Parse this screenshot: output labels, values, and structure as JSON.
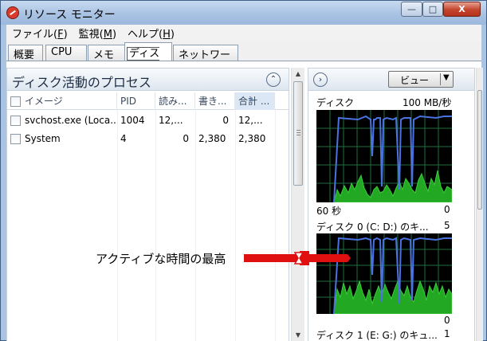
{
  "window": {
    "title": "リソース モニター",
    "min_symbol": "—",
    "max_symbol": "□",
    "close_symbol": "X"
  },
  "menu": [
    {
      "label": "ファイル(",
      "key": "F",
      "end": ")"
    },
    {
      "label": "監視(",
      "key": "M",
      "end": ")"
    },
    {
      "label": "ヘルプ(",
      "key": "H",
      "end": ")"
    }
  ],
  "tabs": [
    "概要",
    "CPU",
    "メモリ",
    "ディスク",
    "ネットワーク"
  ],
  "active_tab": "ディスク",
  "process_panel": {
    "title": "ディスク活動のプロセス",
    "collapse_symbol": "⌃",
    "columns": [
      "イメージ",
      "PID",
      "読み...",
      "書き...",
      "合計 ..."
    ],
    "rows": [
      {
        "image": "svchost.exe (Loca...",
        "pid": "1004",
        "read": "12,...",
        "write": "0",
        "total": "12,..."
      },
      {
        "image": "System",
        "pid": "4",
        "read": "0",
        "write": "2,380",
        "total": "2,380"
      }
    ]
  },
  "graphs_panel": {
    "expand_symbol": "›",
    "view_label": "ビュー",
    "graphs": [
      {
        "title": "ディスク",
        "max_label": "100 MB/秒",
        "time_label": "60 秒",
        "min_label": "0"
      },
      {
        "title": "ディスク 0 (C: D:) のキ...",
        "max_label": "5",
        "min_label": "0"
      },
      {
        "title": "ディスク 1 (E: G:) のキュ...",
        "max_label": "1"
      }
    ]
  },
  "annotation": {
    "text": "アクティブな時間の最高"
  },
  "colors": {
    "graph_bg": "#000000",
    "graph_grid": "#2e8b57",
    "active_time_line": "#4a72e0",
    "activity_fill": "#1fae1f",
    "arrow": "#e01010"
  }
}
